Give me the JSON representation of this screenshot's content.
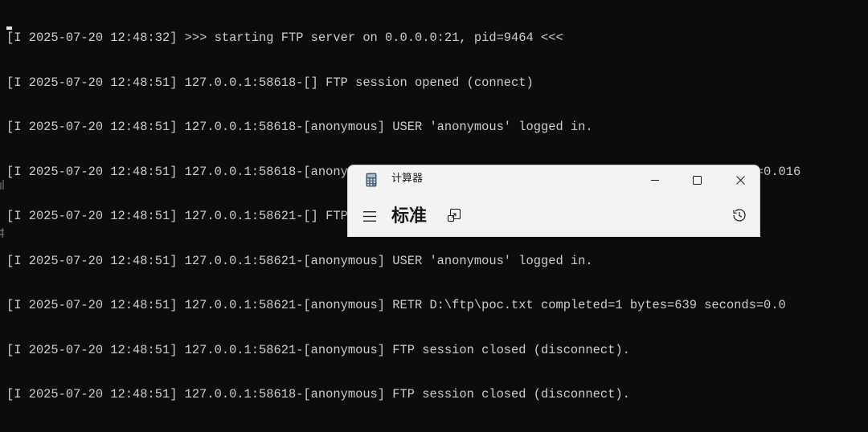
{
  "terminal": {
    "background": "#0c0c0c",
    "text_color": "#cccccc",
    "lines": [
      "[I 2025-07-20 12:48:32] >>> starting FTP server on 0.0.0.0:21, pid=9464 <<<",
      "[I 2025-07-20 12:48:51] 127.0.0.1:58618-[] FTP session opened (connect)",
      "[I 2025-07-20 12:48:51] 127.0.0.1:58618-[anonymous] USER 'anonymous' logged in.",
      "[I 2025-07-20 12:48:51] 127.0.0.1:58618-[anonymous] RETR D:\\ftp\\poc.txt completed=1 bytes=639 seconds=0.016",
      "[I 2025-07-20 12:48:51] 127.0.0.1:58621-[] FTP session opened (connect)",
      "[I 2025-07-20 12:48:51] 127.0.0.1:58621-[anonymous] USER 'anonymous' logged in.",
      "[I 2025-07-20 12:48:51] 127.0.0.1:58621-[anonymous] RETR D:\\ftp\\poc.txt completed=1 bytes=639 seconds=0.0",
      "[I 2025-07-20 12:48:51] 127.0.0.1:58621-[anonymous] FTP session closed (disconnect).",
      "[I 2025-07-20 12:48:51] 127.0.0.1:58618-[anonymous] FTP session closed (disconnect)."
    ]
  },
  "calculator": {
    "title": "计算器",
    "mode_title": "标准",
    "background": "#f3f3f3",
    "icons": {
      "app": "calculator-app-icon",
      "minimize": "minimize-icon",
      "maximize": "maximize-icon",
      "close": "close-icon",
      "menu": "hamburger-menu-icon",
      "keep_on_top": "keep-on-top-icon",
      "history": "history-icon"
    }
  }
}
